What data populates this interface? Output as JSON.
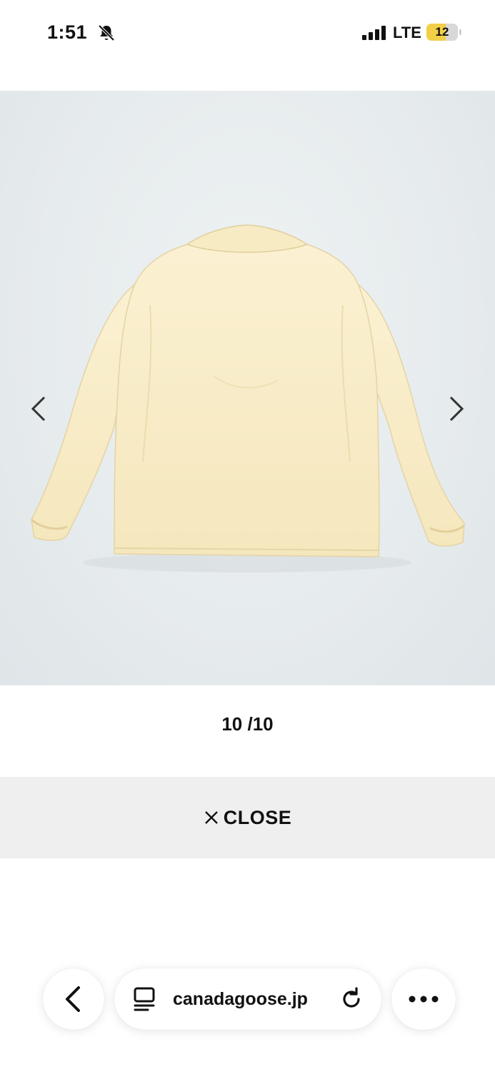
{
  "status_bar": {
    "time": "1:51",
    "network": "LTE",
    "battery": "12",
    "icons": [
      "bell-slash-icon",
      "signal-bars-icon",
      "battery-icon"
    ]
  },
  "gallery": {
    "image_subject": "cream coach jacket back view",
    "counter": "10 /10",
    "prev_icon": "chevron-left-icon",
    "next_icon": "chevron-right-icon"
  },
  "close_button": {
    "icon": "close-icon",
    "label": "CLOSE"
  },
  "browser": {
    "back_icon": "chevron-left-icon",
    "tabs_icon": "tab-overview-icon",
    "url": "canadagoose.jp",
    "reload_icon": "reload-icon",
    "more_icon": "more-dots-icon"
  },
  "colors": {
    "jacket": "#f8ecc6",
    "background": "#e6ebed",
    "close_bar": "#efefef",
    "battery": "#f2cf47"
  }
}
